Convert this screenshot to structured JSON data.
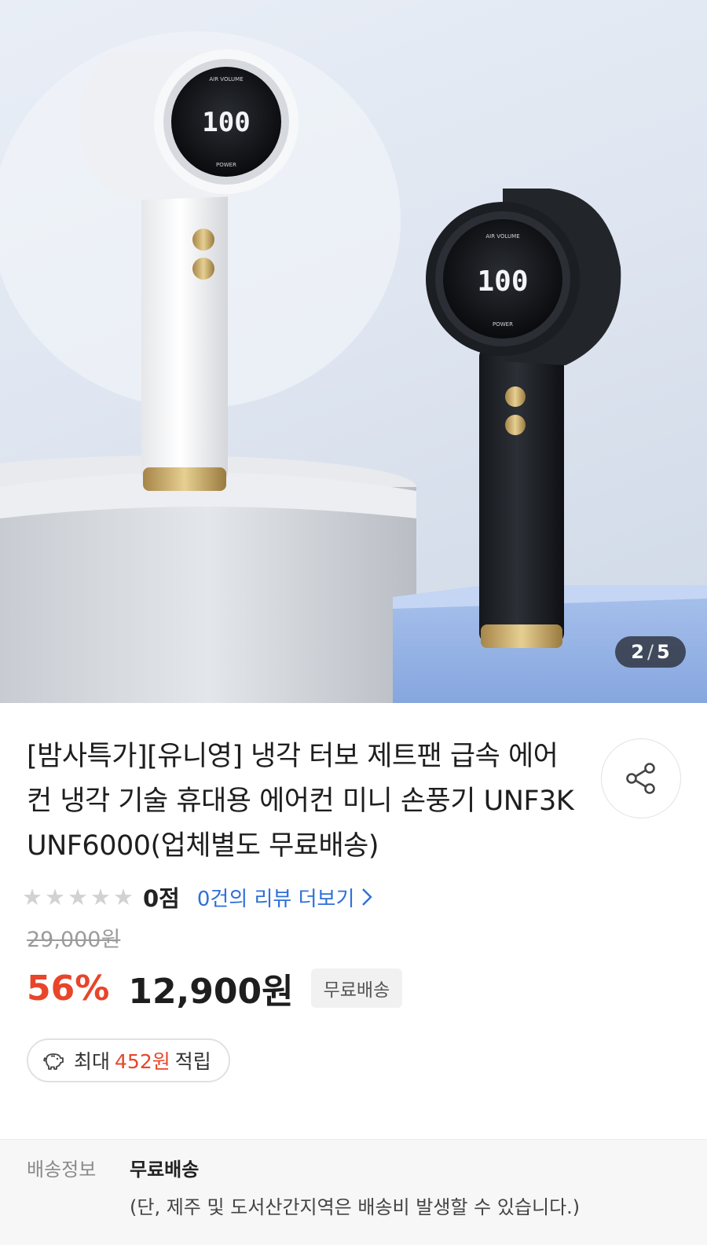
{
  "gallery": {
    "current": "2",
    "separator": "/",
    "total": "5",
    "image_description_icons": [
      "fan-white-icon",
      "fan-black-icon"
    ],
    "display_text": "100",
    "display_top_label": "AIR VOLUME",
    "display_bottom_label": "POWER"
  },
  "product": {
    "title": "[밤사특가][유니영] 냉각 터보 제트팬 급속 에어컨 냉각 기술 휴대용 에어컨 미니 손풍기 UNF3K UNF6000(업체별도 무료배송)",
    "rating": {
      "stars": 5,
      "filled": 0,
      "score_label": "0점",
      "review_link": "0건의 리뷰 더보기"
    },
    "original_price": "29,000원",
    "discount": "56%",
    "price": "12,900원",
    "free_shipping_badge": "무료배송",
    "points": {
      "prefix": "최대",
      "amount": "452원",
      "suffix": "적립"
    }
  },
  "shipping": {
    "label": "배송정보",
    "value": "무료배송",
    "note": "(단, 제주 및 도서산간지역은 배송비 발생할 수 있습니다.)"
  },
  "colors": {
    "accent_red": "#e8452a",
    "link_blue": "#2f6fd8"
  }
}
